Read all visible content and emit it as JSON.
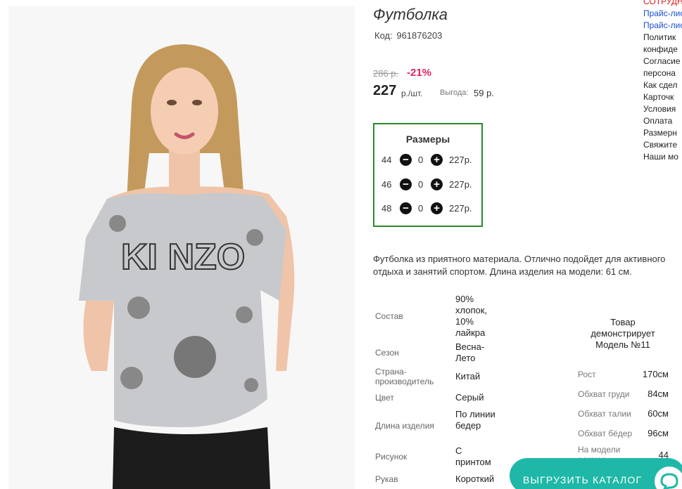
{
  "product": {
    "title": "Футболка",
    "code_label": "Код:",
    "code": "961876203",
    "old_price": "286 р.",
    "discount": "-21%",
    "price": "227",
    "price_unit": "р./шт.",
    "benefit_label": "Выгода:",
    "benefit_value": "59 р."
  },
  "sizes": {
    "title": "Размеры",
    "rows": [
      {
        "size": "44",
        "qty": "0",
        "price": "227р."
      },
      {
        "size": "46",
        "qty": "0",
        "price": "227р."
      },
      {
        "size": "48",
        "qty": "0",
        "price": "227р."
      }
    ]
  },
  "description": "Футболка из приятного материала. Отлично подойдет для активного отдыха и занятий спортом. Длина изделия на модели: 61 см.",
  "characteristics": [
    {
      "label": "Состав",
      "value": "90% хлопок, 10% лайкра"
    },
    {
      "label": "Сезон",
      "value": "Весна-Лето"
    },
    {
      "label": "Страна-производитель",
      "value": "Китай"
    },
    {
      "label": "Цвет",
      "value": "Серый"
    },
    {
      "label": "Длина изделия",
      "value": "По линии бедер"
    },
    {
      "label": "Рисунок",
      "value": "С принтом"
    },
    {
      "label": "Рукав",
      "value": "Короткий"
    }
  ],
  "model": {
    "title": "Товар демонстрирует Модель №11",
    "measurements": [
      {
        "label": "Рост",
        "value": "170см"
      },
      {
        "label": "Обхват груди",
        "value": "84см"
      },
      {
        "label": "Обхват талии",
        "value": "60см"
      },
      {
        "label": "Обхват бёдер",
        "value": "96см"
      },
      {
        "label": "На модели размер",
        "value": "44"
      }
    ]
  },
  "side_links": {
    "items": [
      "СОТРУДН",
      "Прайс-лис",
      "Прайс-лис",
      "Политик",
      "конфиде",
      "Согласие",
      "персона",
      "Как сдел",
      "Карточк",
      "Условия",
      "Оплата",
      "Размерн",
      "Свяжите",
      "Наши мо"
    ]
  },
  "export_button": {
    "label": "ВЫГРУЗИТЬ КАТАЛОГ"
  },
  "colors": {
    "accent_green": "#2a8a2a",
    "discount_red": "#e0245e",
    "button_teal": "#1fb8a8"
  }
}
